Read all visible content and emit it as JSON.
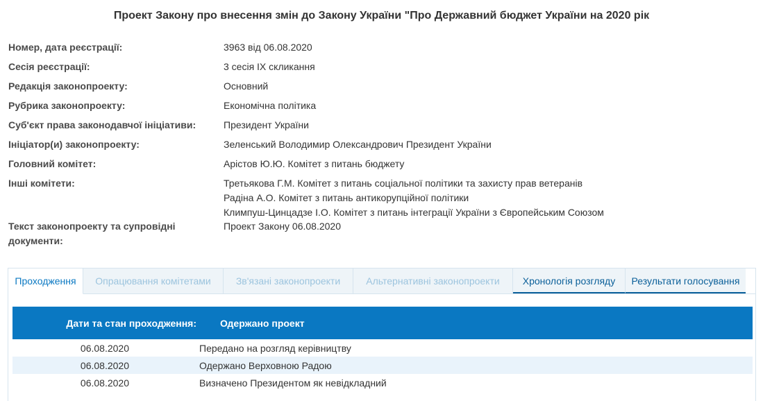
{
  "title": "Проект Закону про внесення змін до Закону України \"Про Державний бюджет України на 2020 рік",
  "info": [
    {
      "label": "Номер, дата реєстрації:",
      "values": [
        "3963 від 06.08.2020"
      ]
    },
    {
      "label": "Сесія реєстрації:",
      "values": [
        "3 сесія IX скликання"
      ]
    },
    {
      "label": "Редакція законопроекту:",
      "values": [
        "Основний"
      ]
    },
    {
      "label": "Рубрика законопроекту:",
      "values": [
        "Економічна політика"
      ]
    },
    {
      "label": "Суб'єкт права законодавчої ініціативи:",
      "values": [
        "Президент України"
      ]
    },
    {
      "label": "Ініціатор(и) законопроекту:",
      "values": [
        "Зеленський Володимир Олександрович Президент України"
      ]
    },
    {
      "label": "Головний комітет:",
      "values": [
        "Арістов Ю.Ю. Комітет з питань бюджету"
      ]
    },
    {
      "label": "Інші комітети:",
      "values": [
        "Третьякова Г.М. Комітет з питань соціальної політики та захисту прав ветеранів",
        "Радіна А.О. Комітет з питань антикорупційної політики",
        "Климпуш-Цинцадзе І.О. Комітет з питань інтеграції України з Європейським Союзом"
      ]
    },
    {
      "label": "Текст законопроекту та супровідні документи:",
      "values": [
        "Проект Закону 06.08.2020"
      ]
    }
  ],
  "tabs": [
    {
      "label": "Проходження",
      "state": "active"
    },
    {
      "label": "Опрацювання комітетами",
      "state": "disabled"
    },
    {
      "label": "Зв'язані законопроекти",
      "state": "disabled"
    },
    {
      "label": "Альтернативні законопроекти",
      "state": "disabled"
    },
    {
      "label": "Хронологія розгляду",
      "state": "enabled"
    },
    {
      "label": "Результати голосування",
      "state": "enabled"
    }
  ],
  "status_table": {
    "header_label": "Дати та стан проходження:",
    "header_status": "Одержано проект",
    "rows": [
      {
        "date": "06.08.2020",
        "event": "Передано на розгляд керівництву"
      },
      {
        "date": "06.08.2020",
        "event": "Одержано Верховною Радою"
      },
      {
        "date": "06.08.2020",
        "event": "Визначено Президентом як невідкладний"
      }
    ]
  },
  "colors": {
    "accent": "#0a78c2",
    "row_alt": "#e9f3fb",
    "tab_bg": "#eef4f8"
  }
}
